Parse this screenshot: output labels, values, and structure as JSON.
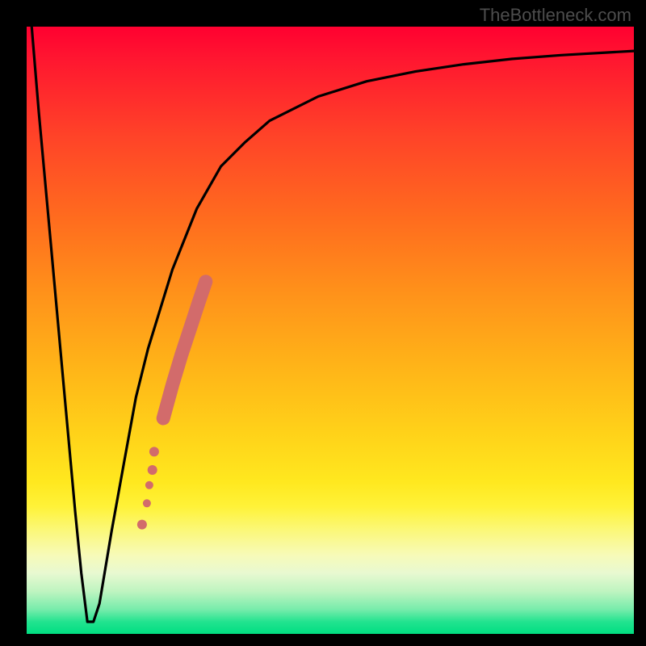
{
  "watermark": "TheBottleneck.com",
  "colors": {
    "bg": "#000000",
    "gradient_top": "#ff0030",
    "gradient_bottom": "#00de82",
    "curve": "#000000",
    "dot": "#d26b6b",
    "watermark": "#4d4d4d"
  },
  "chart_data": {
    "type": "line",
    "title": "",
    "xlabel": "",
    "ylabel": "",
    "xlim": [
      0,
      100
    ],
    "ylim": [
      0,
      100
    ],
    "description": "Black curve plotted over a vertical rainbow gradient. Curve drops steeply from top-left to a narrow flat minimum near x≈10, then rises with a decreasing rate toward the top-right. A cluster of salmon-colored dots lies on the rising limb between x≈19 and x≈30.",
    "series": [
      {
        "name": "main-curve",
        "role": "line",
        "color": "#000000",
        "x": [
          0,
          2,
          4,
          6,
          8,
          9,
          10,
          11,
          12,
          14,
          16,
          18,
          20,
          24,
          28,
          32,
          36,
          40,
          48,
          56,
          64,
          72,
          80,
          88,
          100
        ],
        "y": [
          110,
          86,
          64,
          42,
          20,
          10,
          2,
          2,
          5,
          17,
          28,
          39,
          47,
          60,
          70,
          77,
          81,
          84.5,
          88.5,
          91,
          92.6,
          93.8,
          94.7,
          95.3,
          96
        ]
      },
      {
        "name": "dot-cluster",
        "role": "scatter",
        "color": "#d26b6b",
        "points": [
          {
            "x": 19.0,
            "y": 18.0,
            "r": 6
          },
          {
            "x": 19.8,
            "y": 21.5,
            "r": 5
          },
          {
            "x": 20.2,
            "y": 24.5,
            "r": 5
          },
          {
            "x": 20.7,
            "y": 27.0,
            "r": 6
          },
          {
            "x": 21.0,
            "y": 30.0,
            "r": 6
          },
          {
            "x": 22.5,
            "y": 35.5,
            "r": 8
          },
          {
            "x": 24.0,
            "y": 41.0,
            "r": 8
          },
          {
            "x": 25.5,
            "y": 46.0,
            "r": 8
          },
          {
            "x": 27.0,
            "y": 50.5,
            "r": 8
          },
          {
            "x": 28.3,
            "y": 54.5,
            "r": 8
          },
          {
            "x": 29.5,
            "y": 58.0,
            "r": 8
          }
        ]
      }
    ]
  }
}
